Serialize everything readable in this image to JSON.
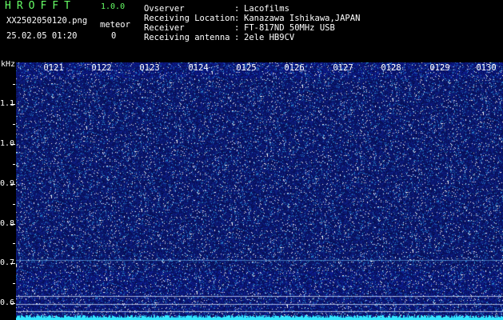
{
  "app": {
    "title": "HROFFT",
    "version": "1.0.0"
  },
  "file": {
    "name": "XX2502050120.png",
    "datetime": "25.02.05 01:20"
  },
  "meteor": {
    "label": "meteor",
    "count": "0"
  },
  "info": [
    {
      "key": "Ovserver",
      "value": "Lacofilms"
    },
    {
      "key": "Receiving Location",
      "value": "Kanazawa Ishikawa,JAPAN"
    },
    {
      "key": "Receiver",
      "value": "FT-817ND 50MHz USB"
    },
    {
      "key": "Receiving antenna",
      "value": "2ele HB9CV"
    }
  ],
  "axis": {
    "unit": "kHz",
    "y_labels": [
      "1.1",
      "1.0",
      "0.9",
      "0.8",
      "0.7",
      "0.6"
    ],
    "x_labels": [
      "0121",
      "0122",
      "0123",
      "0124",
      "0125",
      "0126",
      "0127",
      "0128",
      "0129",
      "0130"
    ]
  },
  "colors": {
    "background": "#000000",
    "title": "#66ff66",
    "text": "#ffffff",
    "waterfall_base": "#0a0f6e",
    "noise_floor": "#33e6ff"
  }
}
